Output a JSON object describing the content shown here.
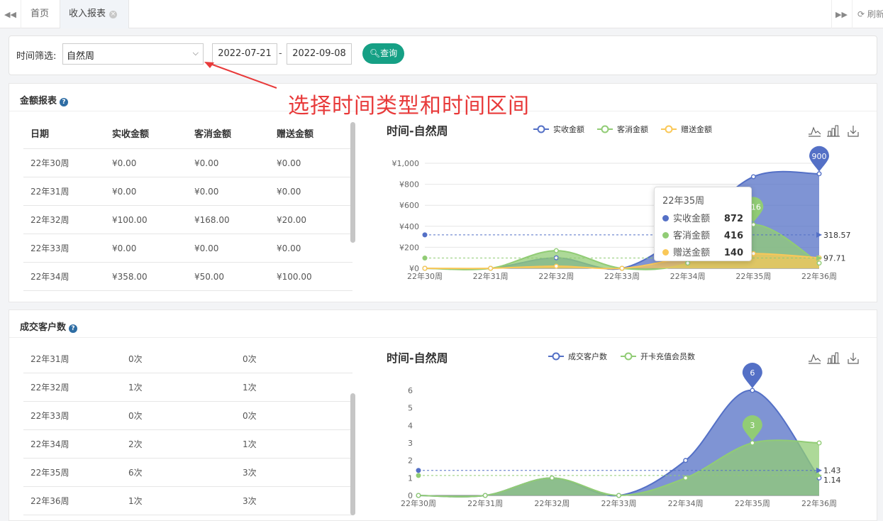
{
  "tabs": {
    "home": "首页",
    "active": "收入报表",
    "refresh": "刷新"
  },
  "filter": {
    "label": "时间筛选:",
    "type_value": "自然周",
    "start_date": "2022-07-21",
    "end_date": "2022-09-08",
    "separator": "-",
    "query_label": "查询"
  },
  "annotation": "选择时间类型和时间区间",
  "colors": {
    "blue": "#5470c6",
    "green": "#91cc75",
    "yellow": "#fac858",
    "primary": "#16a085",
    "annotation": "#e83a3a"
  },
  "amount": {
    "title": "金额报表",
    "headers": [
      "日期",
      "实收金额",
      "客消金额",
      "赠送金额"
    ],
    "rows": [
      [
        "22年30周",
        "¥0.00",
        "¥0.00",
        "¥0.00"
      ],
      [
        "22年31周",
        "¥0.00",
        "¥0.00",
        "¥0.00"
      ],
      [
        "22年32周",
        "¥100.00",
        "¥168.00",
        "¥20.00"
      ],
      [
        "22年33周",
        "¥0.00",
        "¥0.00",
        "¥0.00"
      ],
      [
        "22年34周",
        "¥358.00",
        "¥50.00",
        "¥100.00"
      ]
    ],
    "chart_title": "时间-自然周",
    "tooltip": {
      "title": "22年35周",
      "items": [
        {
          "name": "实收金额",
          "value": "872"
        },
        {
          "name": "客消金额",
          "value": "416"
        },
        {
          "name": "赠送金额",
          "value": "140"
        }
      ]
    }
  },
  "customers": {
    "title": "成交客户数",
    "rows": [
      [
        "22年31周",
        "0次",
        "0次"
      ],
      [
        "22年32周",
        "1次",
        "1次"
      ],
      [
        "22年33周",
        "0次",
        "0次"
      ],
      [
        "22年34周",
        "2次",
        "1次"
      ],
      [
        "22年35周",
        "6次",
        "3次"
      ],
      [
        "22年36周",
        "1次",
        "3次"
      ]
    ],
    "chart_title": "时间-自然周"
  },
  "chart_data": [
    {
      "type": "area",
      "title": "时间-自然周",
      "categories": [
        "22年30周",
        "22年31周",
        "22年32周",
        "22年33周",
        "22年34周",
        "22年35周",
        "22年36周"
      ],
      "ylim": [
        0,
        1000
      ],
      "yticks": [
        0,
        200,
        400,
        600,
        800,
        1000
      ],
      "ytick_labels": [
        "¥0",
        "¥200",
        "¥400",
        "¥600",
        "¥800",
        "¥1,000"
      ],
      "series": [
        {
          "name": "实收金额",
          "color": "#5470c6",
          "values": [
            0,
            0,
            100,
            0,
            358,
            872,
            900
          ],
          "average": 318.57
        },
        {
          "name": "客消金额",
          "color": "#91cc75",
          "values": [
            0,
            0,
            168,
            0,
            50,
            416,
            50
          ],
          "average": 97.71
        },
        {
          "name": "赠送金额",
          "color": "#fac858",
          "values": [
            0,
            0,
            20,
            0,
            100,
            140,
            100
          ]
        }
      ],
      "max_label": "900",
      "green_label": "416",
      "avg_labels": [
        "318.57",
        "97.71"
      ],
      "legend": "top",
      "grid": true
    },
    {
      "type": "area",
      "title": "时间-自然周",
      "categories": [
        "22年30周",
        "22年31周",
        "22年32周",
        "22年33周",
        "22年34周",
        "22年35周",
        "22年36周"
      ],
      "ylim": [
        0,
        6
      ],
      "yticks": [
        0,
        1,
        2,
        3,
        4,
        5,
        6
      ],
      "ytick_labels": [
        "0",
        "1",
        "2",
        "3",
        "4",
        "5",
        "6"
      ],
      "series": [
        {
          "name": "成交客户数",
          "color": "#5470c6",
          "values": [
            0,
            0,
            1,
            0,
            2,
            6,
            1
          ],
          "average": 1.43
        },
        {
          "name": "开卡充值会员数",
          "color": "#91cc75",
          "values": [
            0,
            0,
            1,
            0,
            1,
            3,
            3
          ],
          "average": 1.14
        }
      ],
      "max_label": "6",
      "green_label": "3",
      "avg_labels": [
        "1.43",
        "1.14"
      ],
      "legend": "top",
      "grid": false
    }
  ]
}
